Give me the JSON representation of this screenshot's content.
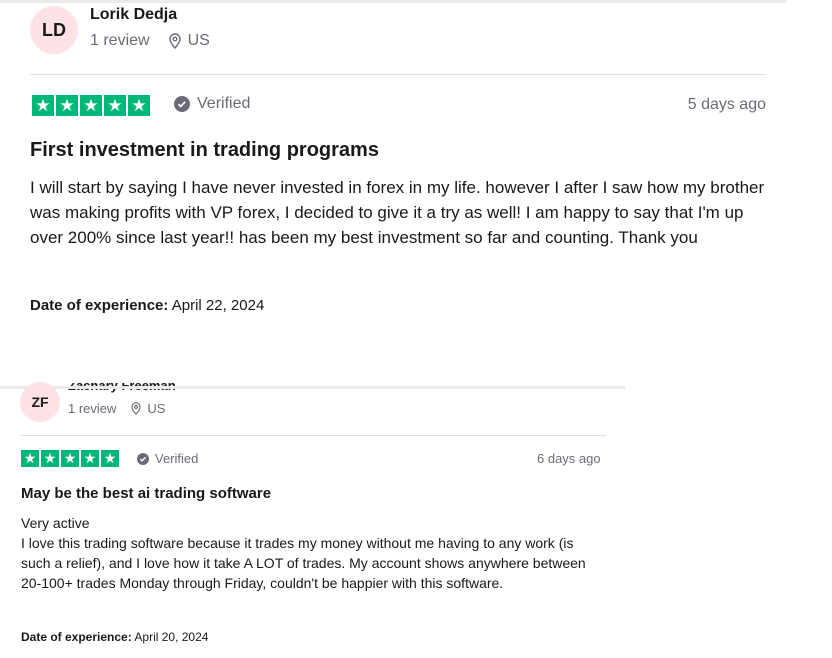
{
  "reviews": [
    {
      "initials": "LD",
      "name": "Lorik Dedja",
      "review_count": "1 review",
      "country": "US",
      "verified_label": "Verified",
      "time_ago": "5 days ago",
      "rating": 5,
      "title": "First investment in trading programs",
      "body": "I will start by saying I have never invested in forex in my life. however I after I saw how my brother was making profits with VP forex, I decided to give it a try as well! I am happy to say that I'm up over 200% since last year!! has been my best investment so far and counting. Thank you",
      "doe_label": "Date of experience:",
      "doe_value": "April 22, 2024"
    },
    {
      "initials": "ZF",
      "name": "Zachary Freeman",
      "review_count": "1 review",
      "country": "US",
      "verified_label": "Verified",
      "time_ago": "6 days ago",
      "rating": 5,
      "title": "May be the best ai trading software",
      "body_line1": "Very active",
      "body": "I love this trading software because it trades my money without me having to any work (is such a relief), and I love how it take A LOT of trades. My account shows anywhere between 20-100+ trades Monday through Friday, couldn't be happier with this software.",
      "doe_label": "Date of experience:",
      "doe_value": "April 20, 2024"
    }
  ],
  "colors": {
    "star_green": "#00b67a",
    "avatar_bg": "#fde2e6",
    "muted": "#6b6b78"
  },
  "icons": {
    "star": "star-icon",
    "pin": "location-pin-icon",
    "verified": "verified-check-icon"
  }
}
